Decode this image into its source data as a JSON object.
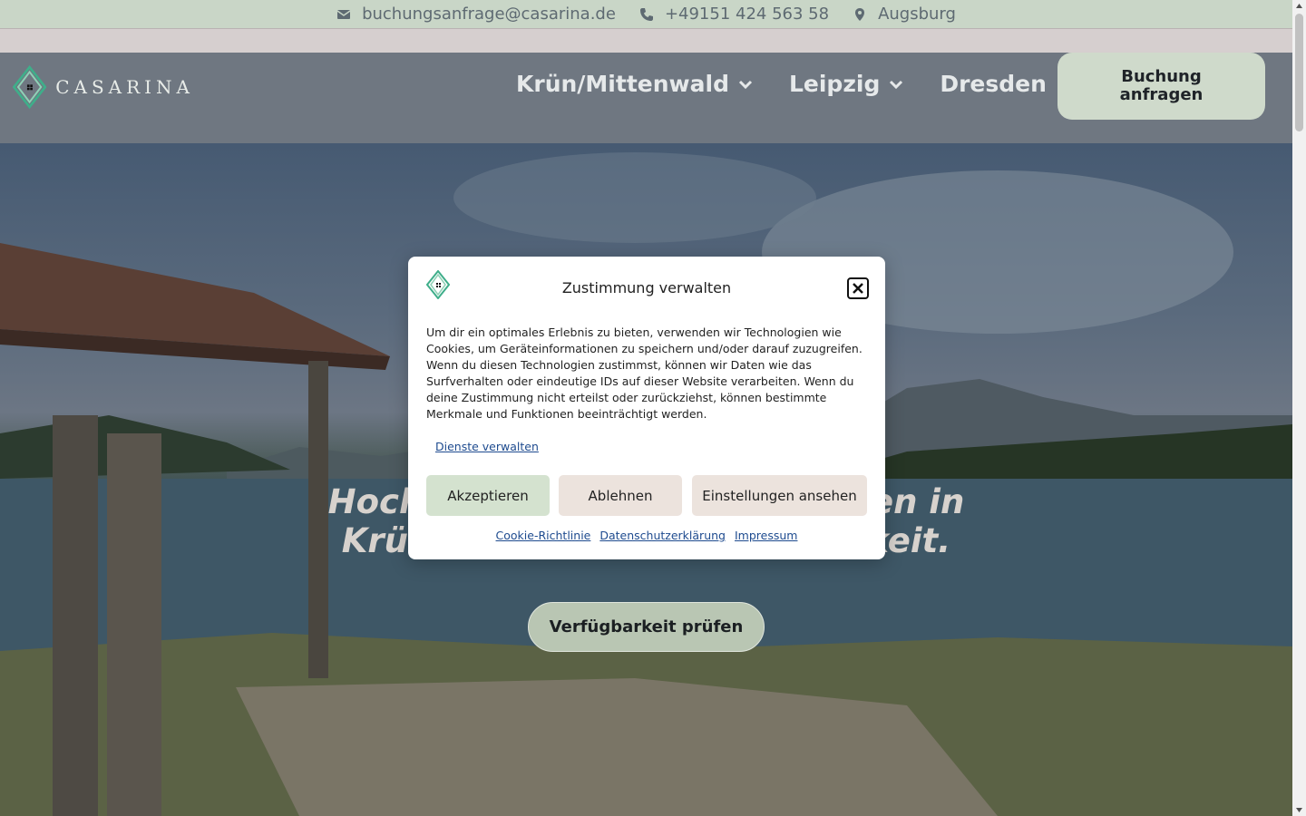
{
  "topbar": {
    "email": "buchungsanfrage@casarina.de",
    "phone": "+49151 424 563 58",
    "location": "Augsburg",
    "icons": [
      "mail-icon",
      "phone-icon",
      "location-pin-icon"
    ]
  },
  "header": {
    "logo_text": "CASARINA",
    "nav": [
      {
        "label": "Krün/Mittenwald",
        "has_dropdown": true
      },
      {
        "label": "Leipzig",
        "has_dropdown": true
      },
      {
        "label": "Dresden",
        "has_dropdown": false
      }
    ],
    "book_button_line1": "Buchung",
    "book_button_line2": "anfragen"
  },
  "hero": {
    "title_line1": "Hochwertige Ferienwohnungen in",
    "title_line2": "Krün – Natur und Gemütlichkeit.",
    "cta_label": "Verfügbarkeit prüfen"
  },
  "consent": {
    "title": "Zustimmung verwalten",
    "text": "Um dir ein optimales Erlebnis zu bieten, verwenden wir Technologien wie Cookies, um Geräteinformationen zu speichern und/oder darauf zuzugreifen. Wenn du diesen Technologien zustimmst, können wir Daten wie das Surfverhalten oder eindeutige IDs auf dieser Website verarbeiten. Wenn du deine Zustimmung nicht erteilst oder zurückziehst, können bestimmte Merkmale und Funktionen beeinträchtigt werden.",
    "manage_link": "Dienste verwalten",
    "accept": "Akzeptieren",
    "deny": "Ablehnen",
    "preferences": "Einstellungen ansehen",
    "links": [
      "Cookie-Richtlinie",
      "Datenschutzerklärung",
      "Impressum"
    ]
  },
  "colors": {
    "topbar_bg": "#c9d6c7",
    "accent_green": "#3fae8a",
    "button_green": "#d4e2cf",
    "button_beige": "#ece3dd",
    "link_blue": "#1e4b8f"
  }
}
